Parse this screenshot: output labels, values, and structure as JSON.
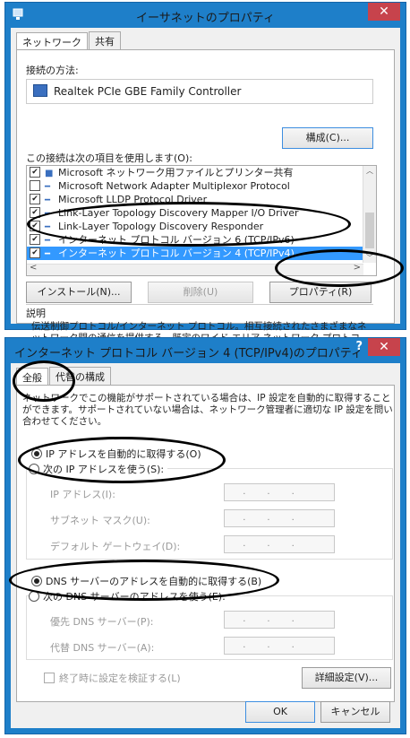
{
  "dlg1": {
    "title": "イーサネットのプロパティ",
    "close_glyph": "✕",
    "tabs": [
      "ネットワーク",
      "共有"
    ],
    "connect_using_label": "接続の方法:",
    "adapter_name": "Realtek PCIe GBE Family Controller",
    "configure_button": "構成(C)...",
    "items_label": "この接続は次の項目を使用します(O):",
    "items": [
      {
        "label": "Microsoft ネットワーク用ファイルとプリンター共有",
        "checked": true
      },
      {
        "label": "Microsoft Network Adapter Multiplexor Protocol",
        "checked": false
      },
      {
        "label": "Microsoft LLDP Protocol Driver",
        "checked": true
      },
      {
        "label": "Link-Layer Topology Discovery Mapper I/O Driver",
        "checked": true
      },
      {
        "label": "Link-Layer Topology Discovery Responder",
        "checked": true
      },
      {
        "label": "インターネット プロトコル バージョン 6 (TCP/IPv6)",
        "checked": true
      },
      {
        "label": "インターネット プロトコル バージョン 4 (TCP/IPv4)",
        "checked": true,
        "selected": true
      }
    ],
    "install_button": "インストール(N)...",
    "uninstall_button": "削除(U)",
    "properties_button": "プロパティ(R)",
    "description_label": "説明",
    "description_text": "伝送制御プロトコル/インターネット プロトコル。相互接続されたさまざまなネットワーク間の通信を提供する、既定のワイド エリア ネットワーク プロトコルです。"
  },
  "dlg2": {
    "title": "インターネット プロトコル バージョン 4 (TCP/IPv4)のプロパティ",
    "help_glyph": "?",
    "close_glyph": "✕",
    "tabs": [
      "全般",
      "代替の構成"
    ],
    "intro_text": "ネットワークでこの機能がサポートされている場合は、IP 設定を自動的に取得することができます。サポートされていない場合は、ネットワーク管理者に適切な IP 設定を問い合わせてください。",
    "ip_auto_label": "IP アドレスを自動的に取得する(O)",
    "ip_manual_label": "次の IP アドレスを使う(S):",
    "ip_address_label": "IP アドレス(I):",
    "subnet_label": "サブネット マスク(U):",
    "gateway_label": "デフォルト ゲートウェイ(D):",
    "dns_auto_label": "DNS サーバーのアドレスを自動的に取得する(B)",
    "dns_manual_label": "次の DNS サーバーのアドレスを使う(E):",
    "preferred_dns_label": "優先 DNS サーバー(P):",
    "alternate_dns_label": "代替 DNS サーバー(A):",
    "ip_placeholder": "...",
    "validate_label": "終了時に設定を検証する(L)",
    "advanced_button": "詳細設定(V)...",
    "ok_button": "OK",
    "cancel_button": "キャンセル"
  },
  "colors": {
    "title_bar": "#1e7fc9",
    "close": "#c7434c",
    "selection": "#3399ff"
  }
}
